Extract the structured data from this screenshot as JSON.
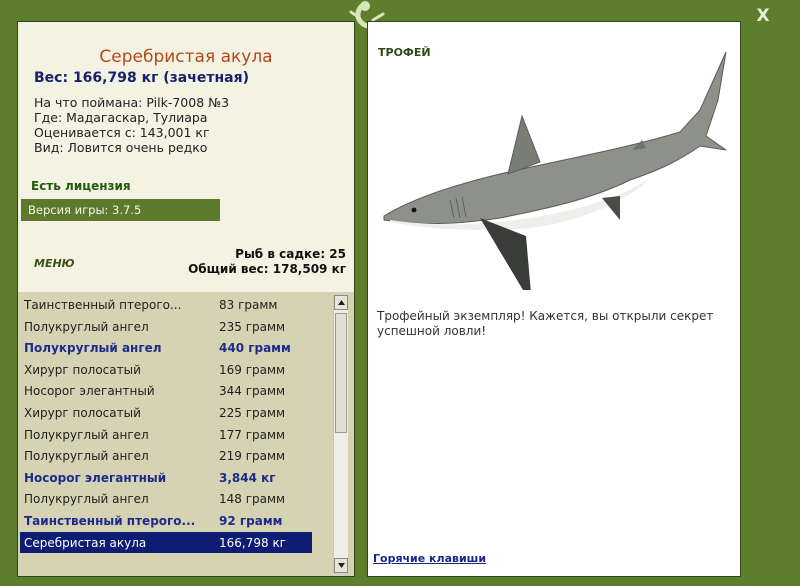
{
  "window": {
    "close_symbol": "X"
  },
  "left": {
    "fish_name": "Серебристая акула",
    "weight_line": "Вес: 166,798 кг (зачетная)",
    "info": [
      "На что поймана: Pilk-7008 №3",
      "Где: Мадагаскар, Тулиара",
      "Оценивается с: 143,001 кг",
      "Вид: Ловится очень редко"
    ],
    "license": "Есть лицензия",
    "version": "Версия игры: 3.7.5",
    "menu": "МЕНЮ",
    "keep_count": "Рыб в садке: 25",
    "keep_weight": "Общий вес: 178,509 кг"
  },
  "catch_list": [
    {
      "name": "Таинственный птерого...",
      "weight": "83 грамм",
      "trophy": false
    },
    {
      "name": "Полукруглый ангел",
      "weight": "235 грамм",
      "trophy": false
    },
    {
      "name": "Полукруглый ангел",
      "weight": "440 грамм",
      "trophy": true
    },
    {
      "name": "Хирург полосатый",
      "weight": "169 грамм",
      "trophy": false
    },
    {
      "name": "Носорог элегантный",
      "weight": "344 грамм",
      "trophy": false
    },
    {
      "name": "Хирург полосатый",
      "weight": "225 грамм",
      "trophy": false
    },
    {
      "name": "Полукруглый ангел",
      "weight": "177 грамм",
      "trophy": false
    },
    {
      "name": "Полукруглый ангел",
      "weight": "219 грамм",
      "trophy": false
    },
    {
      "name": "Носорог элегантный",
      "weight": "3,844 кг",
      "trophy": true
    },
    {
      "name": "Полукруглый ангел",
      "weight": "148 грамм",
      "trophy": false
    },
    {
      "name": "Таинственный птерого...",
      "weight": "92 грамм",
      "trophy": true
    },
    {
      "name": "Серебристая акула",
      "weight": "166,798 кг",
      "trophy": false,
      "selected": true
    }
  ],
  "right": {
    "trophy_label": "ТРОФЕЙ",
    "trophy_text": "Трофейный экземпляр! Кажется, вы открыли секрет успешной ловли!",
    "hotkeys": "Горячие клавиши",
    "fish_image": "silky-shark-icon"
  },
  "colors": {
    "frame": "#5e7e2e",
    "panel_bg": "#f4f2e2",
    "list_bg": "#d6d3b4",
    "title": "#b44817",
    "trophy_text": "#1d2b8a",
    "selected_row": "#0e1c72"
  }
}
